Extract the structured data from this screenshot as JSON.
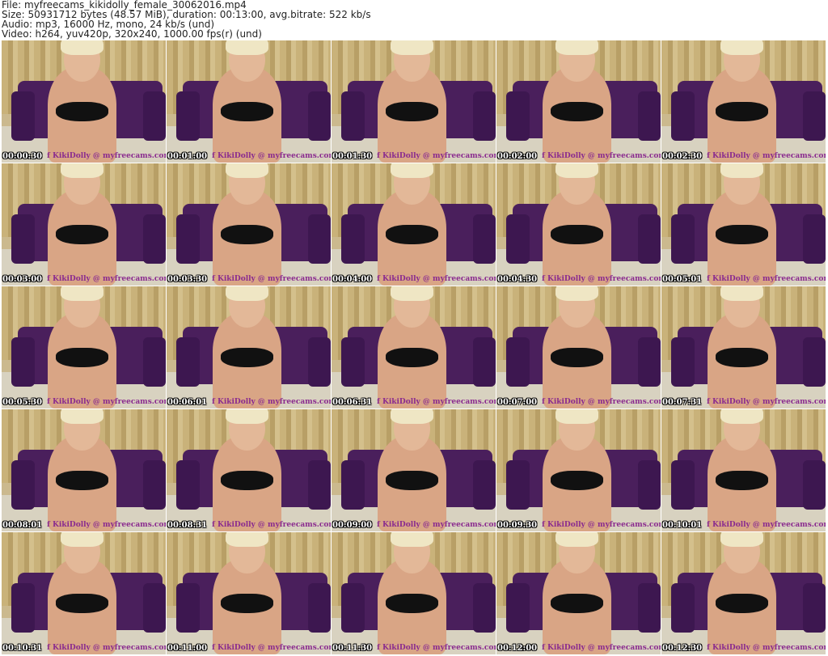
{
  "header": {
    "file": "File: myfreecams_kikidolly_female_30062016.mp4",
    "size": "Size: 50931712 bytes (48.57 MiB), duration: 00:13:00, avg.bitrate: 522 kb/s",
    "audio": "Audio: mp3, 16000 Hz, mono, 24 kb/s (und)",
    "video": "Video: h264, yuv420p, 320x240, 1000.00 fps(r) (und)"
  },
  "watermark": "f KikiDolly @ myfreecams.com",
  "thumbnails": [
    "00:00:30",
    "00:01:00",
    "00:01:30",
    "00:02:00",
    "00:02:30",
    "00:03:00",
    "00:03:30",
    "00:04:00",
    "00:04:30",
    "00:05:01",
    "00:05:30",
    "00:06:01",
    "00:06:31",
    "00:07:00",
    "00:07:31",
    "00:08:01",
    "00:08:31",
    "00:09:00",
    "00:09:30",
    "00:10:01",
    "00:10:31",
    "00:11:00",
    "00:11:30",
    "00:12:00",
    "00:12:30"
  ]
}
